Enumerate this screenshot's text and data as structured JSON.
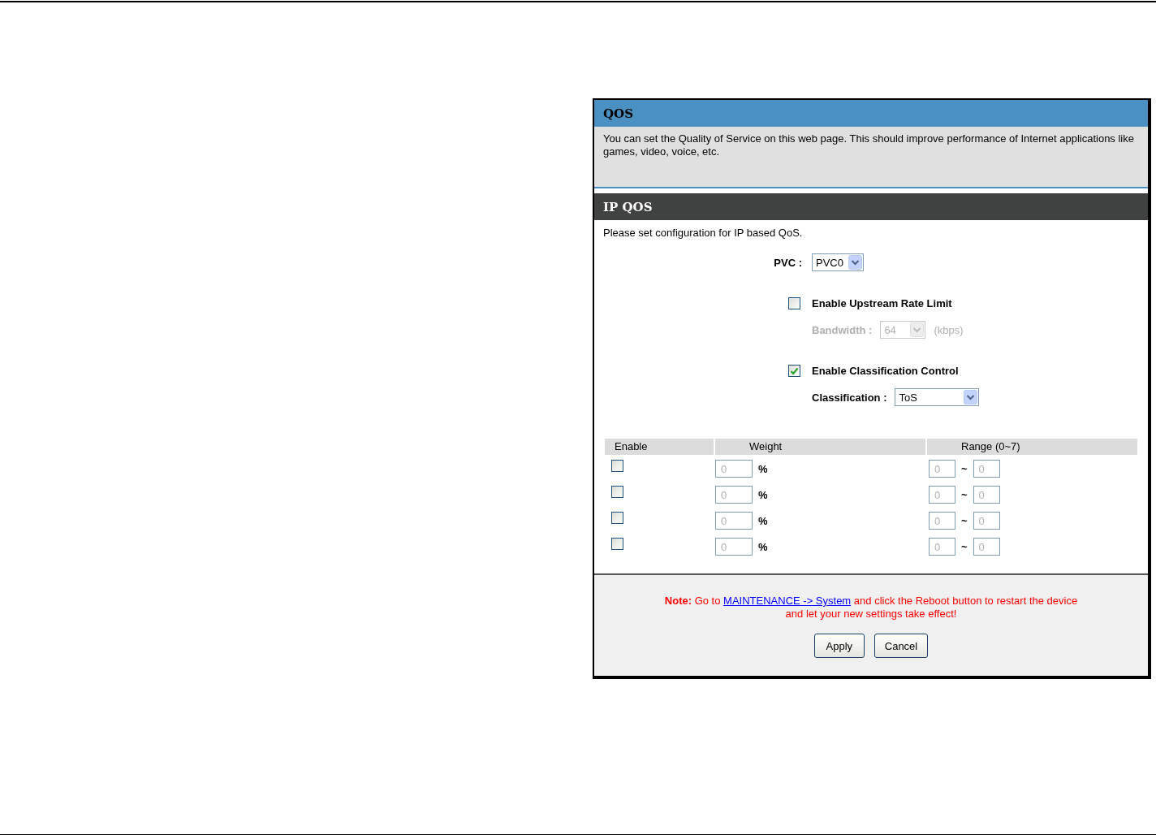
{
  "qos": {
    "title": "QOS",
    "description": "You can set the Quality of Service on this web page. This should improve performance of Internet applications like games, video, voice, etc."
  },
  "ip_qos": {
    "title": "IP QOS",
    "intro": "Please set configuration for IP based QoS.",
    "pvc": {
      "label": "PVC :",
      "value": "PVC0"
    },
    "upstream": {
      "label": "Enable Upstream Rate Limit",
      "checked": false,
      "bandwidth_label": "Bandwidth :",
      "bandwidth_value": "64",
      "unit": "(kbps)"
    },
    "classification_control": {
      "label": "Enable Classification Control",
      "checked": true,
      "classification_label": "Classification :",
      "value": "ToS"
    },
    "table": {
      "columns": [
        "Enable",
        "Weight",
        "Range (0~7)"
      ],
      "rows": [
        {
          "checked": false,
          "weight": "0",
          "weight_unit": "%",
          "range_from": "0",
          "range_separator": "~",
          "range_to": "0"
        },
        {
          "checked": false,
          "weight": "0",
          "weight_unit": "%",
          "range_from": "0",
          "range_separator": "~",
          "range_to": "0"
        },
        {
          "checked": false,
          "weight": "0",
          "weight_unit": "%",
          "range_from": "0",
          "range_separator": "~",
          "range_to": "0"
        },
        {
          "checked": false,
          "weight": "0",
          "weight_unit": "%",
          "range_from": "0",
          "range_separator": "~",
          "range_to": "0"
        }
      ]
    }
  },
  "note": {
    "lead": "**Note:** Go to",
    "link": "MAINTENANCE -> System",
    "rest": "and click the Reboot button to restart the device",
    "line_2": "and let your new settings take effect!"
  },
  "buttons": [
    "Apply",
    "Cancel"
  ]
}
